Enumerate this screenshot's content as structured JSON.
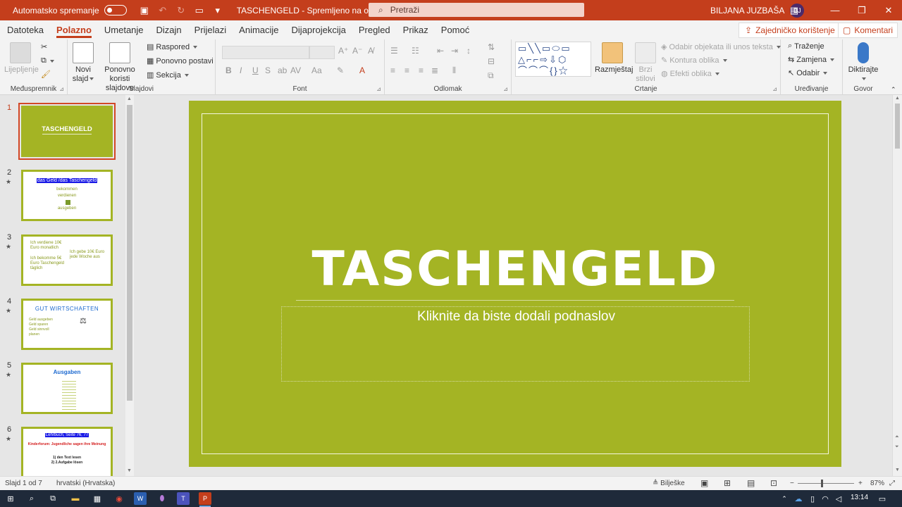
{
  "titlebar": {
    "autosave_label": "Automatsko spremanje",
    "doc_title": "TASCHENGELD  -  Spremljeno na ovaj PC",
    "search_placeholder": "Pretraži",
    "user_name": "BILJANA JUZBAŠA",
    "user_initials": "BJ"
  },
  "tabs": [
    "Datoteka",
    "Polazno",
    "Umetanje",
    "Dizajn",
    "Prijelazi",
    "Animacije",
    "Dijaprojekcija",
    "Pregled",
    "Prikaz",
    "Pomoć"
  ],
  "active_tab": "Polazno",
  "share_label": "Zajedničko korištenje",
  "comments_label": "Komentari",
  "ribbon": {
    "clipboard": {
      "paste_l1": "Lijepljenje",
      "group": "Međuspremnik"
    },
    "slides": {
      "new_l1": "Novi",
      "new_l2": "slajd",
      "reuse_l1": "Ponovno",
      "reuse_l2": "koristi slajdove",
      "layout": "Raspored",
      "reset": "Ponovno postavi",
      "section": "Sekcija",
      "group": "Slajdovi"
    },
    "font": {
      "bold": "B",
      "italic": "I",
      "underline": "U",
      "strike": "S",
      "group": "Font"
    },
    "paragraph": {
      "group": "Odlomak"
    },
    "drawing": {
      "arrange": "Razmještaj",
      "quick_l1": "Brzi",
      "quick_l2": "stilovi",
      "select_objects": "Odabir objekata ili unos teksta",
      "outline": "Kontura oblika",
      "effects": "Efekti oblika",
      "group": "Crtanje"
    },
    "editing": {
      "find": "Traženje",
      "replace": "Zamjena",
      "select": "Odabir",
      "group": "Uređivanje"
    },
    "voice": {
      "dictate": "Diktirajte",
      "group": "Govor"
    }
  },
  "thumbnails": [
    {
      "num": "1",
      "title": "TASCHENGELD"
    },
    {
      "num": "2",
      "title": "das Geld /das Taschengeld",
      "lines": [
        "bekommen",
        "verdienen",
        "ausgeben"
      ]
    },
    {
      "num": "3",
      "lines": [
        "Ich verdiene 10€",
        "Euro monatlich",
        "Ich bekomme 5€",
        "Euro Taschengeld",
        "täglich",
        "Ich gebe 10€ Euro",
        "jede Woche aus"
      ]
    },
    {
      "num": "4",
      "title": "GUT WIRTSCHAFTEN",
      "lines": [
        "Geld ausgeben",
        "Geld sparen",
        "Geld sinnvoll",
        "planen"
      ]
    },
    {
      "num": "5",
      "title": "Ausgaben"
    },
    {
      "num": "6",
      "title": "Lehrbuch, Seite 76, 77",
      "subtitle": "Kinderforum: Jugendliche sagen ihre Meinung",
      "lines": [
        "1) den Text lesen",
        "2) 2.Aufgabe lösen"
      ]
    }
  ],
  "slide": {
    "title": "TASCHENGELD",
    "subtitle_placeholder": "Kliknite da biste dodali podnaslov",
    "background_color": "#a4b424"
  },
  "statusbar": {
    "slide_counter": "Slajd 1 od 7",
    "language": "hrvatski (Hrvatska)",
    "notes": "Bilješke",
    "zoom": "87%"
  },
  "taskbar": {
    "time": "13:14"
  },
  "colors": {
    "accent": "#c43e1c",
    "slide_green": "#a4b424"
  }
}
